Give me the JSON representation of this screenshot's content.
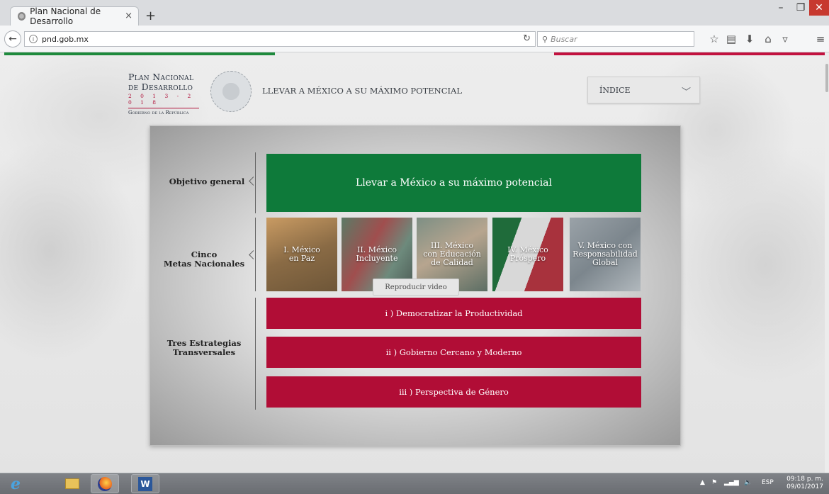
{
  "browser": {
    "tab_title": "Plan Nacional de Desarrollo",
    "tab_close": "×",
    "new_tab": "+",
    "url": "pnd.gob.mx",
    "search_placeholder": "Buscar",
    "window_min": "–",
    "window_max": "❐",
    "window_close": "✕",
    "icons": [
      "back-icon",
      "info-icon",
      "reload-icon",
      "search-icon",
      "star-icon",
      "reading-list-icon",
      "download-icon",
      "home-icon",
      "pocket-icon",
      "menu-icon"
    ]
  },
  "header": {
    "logo_line1": "Plan Nacional",
    "logo_line2": "de Desarrollo",
    "logo_years": "2 0 1 3 - 2 0 1 8",
    "logo_gov": "Gobierno de la República",
    "slogan": "LLEVAR A MÉXICO A SU MÁXIMO POTENCIAL",
    "index_label": "ÍNDICE"
  },
  "panel": {
    "objective_label": "Objetivo general",
    "objective_text": "Llevar a México a su máximo potencial",
    "goals_label_line1": "Cinco",
    "goals_label_line2": "Metas Nacionales",
    "goals": [
      {
        "line1": "I. México",
        "line2": "en Paz",
        "line3": ""
      },
      {
        "line1": "II. México",
        "line2": "Incluyente",
        "line3": ""
      },
      {
        "line1": "III. México",
        "line2": "con Educación",
        "line3": "de Calidad"
      },
      {
        "line1": "IV. México",
        "line2": "Próspero",
        "line3": ""
      },
      {
        "line1": "V. México con",
        "line2": "Responsabilidad",
        "line3": "Global"
      }
    ],
    "video_button": "Reproducir video",
    "strategies_label_line1": "Tres Estrategias",
    "strategies_label_line2": "Transversales",
    "strategies": [
      "i ) Democratizar la Productividad",
      "ii ) Gobierno Cercano y Moderno",
      "iii ) Perspectiva de Género"
    ]
  },
  "taskbar": {
    "language": "ESP",
    "time": "09:18 p. m.",
    "date": "09/01/2017",
    "word_label": "W"
  },
  "colors": {
    "green": "#0e7a3a",
    "red": "#b10d36",
    "stripe_green": "#1e8a3c",
    "stripe_red": "#c2123f"
  }
}
